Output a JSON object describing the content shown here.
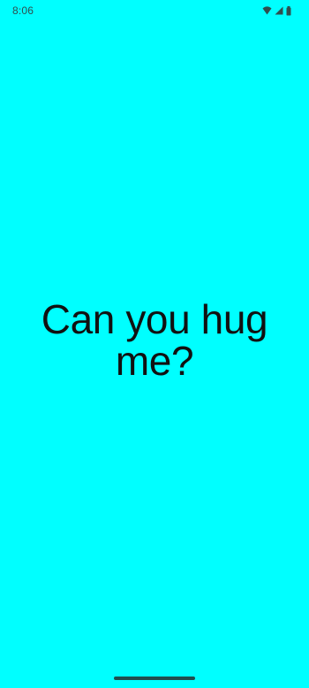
{
  "status_bar": {
    "time": "8:06",
    "icons": [
      "wifi-icon",
      "signal-icon",
      "battery-icon"
    ]
  },
  "main": {
    "message": "Can you hug me?"
  },
  "colors": {
    "background": "#00ffff",
    "text": "#111111"
  }
}
